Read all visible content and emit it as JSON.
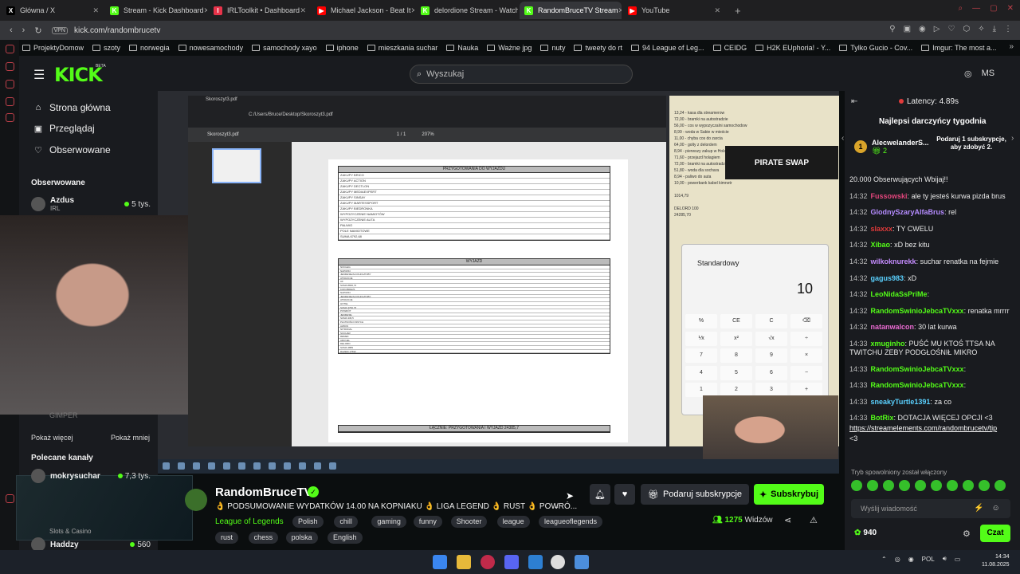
{
  "browser": {
    "tabs": [
      {
        "title": "Główna / X",
        "fav": "X",
        "color": "#000000"
      },
      {
        "title": "Stream - Kick Dashboard",
        "fav": "K",
        "color": "#53fc18"
      },
      {
        "title": "IRLToolkit • Dashboard",
        "fav": "I",
        "color": "#e8334a"
      },
      {
        "title": "Michael Jackson - Beat It",
        "fav": "▶",
        "color": "#ff0000"
      },
      {
        "title": "delordione Stream - Watch",
        "fav": "K",
        "color": "#53fc18"
      },
      {
        "title": "RandomBruceTV Stream",
        "fav": "K",
        "color": "#53fc18"
      },
      {
        "title": "YouTube",
        "fav": "▶",
        "color": "#ff0000"
      }
    ],
    "active_tab": 5,
    "vpn_label": "VPN",
    "url": "kick.com/randombrucetv",
    "bookmarks": [
      "ProjektyDomow",
      "szoty",
      "norwegia",
      "nowesamochody",
      "samochody xayo",
      "iphone",
      "mieszkania suchar",
      "Nauka",
      "Ważne jpg",
      "nuty",
      "tweety do rt",
      "94 League of Leg...",
      "CEIDG",
      "H2K EUphoria! - Y...",
      "Tylko Gucio - Cov...",
      "Imgur: The most a..."
    ]
  },
  "kick": {
    "logo": "KICK",
    "beta": "BETA",
    "search_placeholder": "Wyszukaj",
    "user_initials": "MS",
    "nav": [
      {
        "label": "Strona główna",
        "icon": "⌂"
      },
      {
        "label": "Przeglądaj",
        "icon": "▣"
      },
      {
        "label": "Obserwowane",
        "icon": "♡"
      }
    ],
    "followed_title": "Obserwowane",
    "followed": [
      {
        "name": "Azdus",
        "sub": "IRL",
        "viewers": "5 tys."
      }
    ],
    "muted_text": "GIMPER",
    "show_more": "Pokaż więcej",
    "show_less": "Pokaż mniej",
    "recommended_title": "Polecane kanały",
    "recommended": [
      {
        "name": "mokrysuchar",
        "sub": "",
        "viewers": "7,3 tys."
      },
      {
        "name": "Slots & Casino",
        "sub": "",
        "viewers": ""
      },
      {
        "name": "Haddzy",
        "sub": "",
        "viewers": "560"
      }
    ]
  },
  "stream": {
    "pdf_title": "Skoroszyt3.pdf",
    "pdf_path": "C:/Users/Bruce/Desktop/Skoroszyt3.pdf",
    "pdf_zoom": "207%",
    "pdf_page": "1 / 1",
    "table1_title": "PRZYGOTOWANIA DO WYJAZDU",
    "table1_rows": [
      "ZAKUPY BRICO",
      "ZAKUPY ACTION",
      "ZAKUPY DECTLON",
      "ZAKUPY MEDIAEXPERT",
      "ZAKUPY SINSAY",
      "ZAKUPY MARTESSPORT",
      "ZAKUPY BIEDRONKA",
      "WYPOZYCZENIE NAMIOTÓW",
      "WYPOZYCZENIE AUTA",
      "PALIWO",
      "POLE NAMIOTOWE",
      "SUMA 6792,68"
    ],
    "table2_title": "WYJAZD",
    "table2_rows": [
      "NOCLEG",
      "NAPIWKI",
      "JEDZENIE/ALKOHOL/PUBY",
      "ATRAKCJE",
      "AF",
      "SUMA 8836,72",
      "KOKOBREJS",
      "NAPIWKI",
      "JEDZENIE/ALKOHOL/PUBY",
      "ATRAKCJE",
      "HOTEL",
      "SUMA 3760,76",
      "POWRÓT",
      "JEDZENIE",
      "SUMA 336,5",
      "PŁATNOŚCI INNYCH",
      "AZDUS",
      "NITRODAL",
      "SUCHAR",
      "REMEK",
      "ARCUEL",
      "DELORD",
      "SUMA 4889",
      "RAZEM 17592"
    ],
    "table3_title": "ŁĄCZNIE: PRZYGOTOWANIA I WYJAZD 24385,7",
    "notepad": [
      "13,24 - kasa dla streamerow",
      "72,00 - bramki na autostradzie",
      "56,00 - cos w wypozyczalni samochodow",
      "8,99 - woda w Sabie w mieście",
      "11,00 - chyba cos do zarcia",
      "64,00 - golty z delordem",
      "8,94 - pierwszy zakup w Holandii",
      "71,60 - przejazd holagiem",
      "72,00 - bramki na autostradzie",
      "51,80 - woda dla sochara",
      "8,94 - paliwo do auta",
      "10,00 - powerbank kabel kimnetr",
      "",
      "1014,79",
      "",
      "DELORD 100",
      "24285,70"
    ],
    "pirate_text": "PIRATE SWAP",
    "calc_mode": "Standardowy",
    "calc_display": "10",
    "calc_keys": [
      "%",
      "CE",
      "C",
      "⌫",
      "⅟x",
      "x²",
      "√x",
      "÷",
      "7",
      "8",
      "9",
      "×",
      "4",
      "5",
      "6",
      "−",
      "1",
      "2",
      "3",
      "+"
    ]
  },
  "channel": {
    "name": "RandomBruceTV",
    "title": "👌 PODSUMOWANIE WYDATKÓW 14.00 NA KOPNIAKU 👌 LIGA LEGEND 👌 RUST 👌 POWRÓ...",
    "category": "League of Legends",
    "tags": [
      "Polish",
      "chill",
      "gaming",
      "funny",
      "Shooter",
      "league",
      "leagueoflegends",
      "rust",
      "chess",
      "polska",
      "English"
    ],
    "gift_button": "Podaruj subskrypcje",
    "subscribe_button": "Subskrybuj",
    "viewers": "1275",
    "viewers_label": "Widzów"
  },
  "chat": {
    "latency": "Latency: 4.89s",
    "top_gifters_title": "Najlepsi darczyńcy tygodnia",
    "top_gifter": {
      "rank": "1",
      "name": "AlecwelanderS...",
      "count": "2"
    },
    "gift_cta": "Podaruj 1 subskrypcje, aby zdobyć 2.",
    "messages": [
      {
        "time": "",
        "user": "",
        "text": "20.000 Obserwujących Wbijaj!!",
        "color": "#ffffff"
      },
      {
        "time": "14:32",
        "user": "Fussowski",
        "text": "ale ty jesteś kurwa pizda brus",
        "color": "#e0457b"
      },
      {
        "time": "14:32",
        "user": "GlodnySzaryAlfaBrus",
        "text": "rel",
        "color": "#b58cff"
      },
      {
        "time": "14:32",
        "user": "slaxxx",
        "text": "TY CWELU",
        "color": "#e03a3a"
      },
      {
        "time": "14:32",
        "user": "Xibao",
        "text": "xD bez kitu",
        "color": "#53fc18"
      },
      {
        "time": "14:32",
        "user": "wilkoknurekk",
        "text": "suchar renatka na fejmie",
        "color": "#c58cff"
      },
      {
        "time": "14:32",
        "user": "gagus983",
        "text": "xD",
        "color": "#5ad1ff"
      },
      {
        "time": "14:32",
        "user": "LeoNidaSsPriMe",
        "text": "",
        "color": "#53fc18"
      },
      {
        "time": "14:32",
        "user": "RandomSwinioJebcaTVxxx",
        "text": "renatka mrrrr",
        "color": "#53fc18"
      },
      {
        "time": "14:32",
        "user": "natanwalcon",
        "text": "30 lat kurwa",
        "color": "#e86ad0"
      },
      {
        "time": "14:33",
        "user": "xmuginho",
        "text": "PUŚĆ MU KTOŚ TTSA NA TWITCHU ZEBY PODGŁOŚNIŁ MIKRO",
        "color": "#53fc18"
      },
      {
        "time": "14:33",
        "user": "RandomSwinioJebcaTVxxx",
        "text": "",
        "color": "#53fc18"
      },
      {
        "time": "14:33",
        "user": "RandomSwinioJebcaTVxxx",
        "text": "",
        "color": "#53fc18"
      },
      {
        "time": "14:33",
        "user": "sneakyTurtle1391",
        "text": "za co",
        "color": "#5ad1ff"
      },
      {
        "time": "14:33",
        "user": "BotRix",
        "text": "DOTACJA WIĘCEJ OPCJI <3",
        "color": "#53fc18"
      },
      {
        "time": "",
        "user": "",
        "text": "https://streamelements.com/randombrucetv/tip",
        "color": "#ffffff",
        "link": true
      },
      {
        "time": "",
        "user": "",
        "text": "<3",
        "color": "#ffffff"
      }
    ],
    "slow_mode": "Tryb spowolniony został włączony",
    "input_placeholder": "Wyślij wiadomość",
    "points": "940",
    "send_button": "Czat"
  },
  "taskbar": {
    "lang": "POL",
    "time": "14:34",
    "date": "11.08.2025"
  }
}
